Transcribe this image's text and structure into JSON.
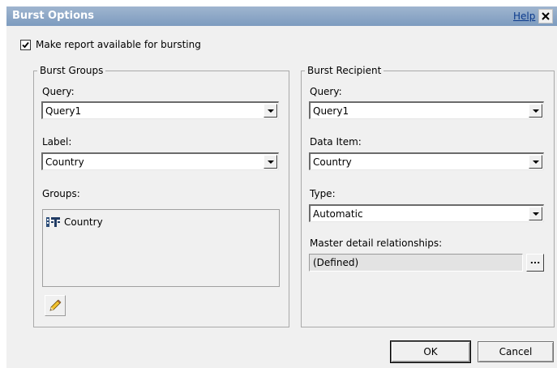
{
  "dialog": {
    "title": "Burst Options",
    "help_label": "Help"
  },
  "bursting": {
    "checkbox_label": "Make report available for bursting",
    "checked": true
  },
  "burst_groups": {
    "legend": "Burst Groups",
    "query_label": "Query:",
    "query_value": "Query1",
    "label_label": "Label:",
    "label_value": "Country",
    "groups_label": "Groups:",
    "groups": [
      {
        "label": "Country",
        "icon": "data-item-icon"
      }
    ]
  },
  "burst_recipient": {
    "legend": "Burst Recipient",
    "query_label": "Query:",
    "query_value": "Query1",
    "data_item_label": "Data Item:",
    "data_item_value": "Country",
    "type_label": "Type:",
    "type_value": "Automatic",
    "master_detail_label": "Master detail relationships:",
    "master_detail_value": "(Defined)",
    "ellipsis_label": "..."
  },
  "footer": {
    "ok_label": "OK",
    "cancel_label": "Cancel"
  }
}
